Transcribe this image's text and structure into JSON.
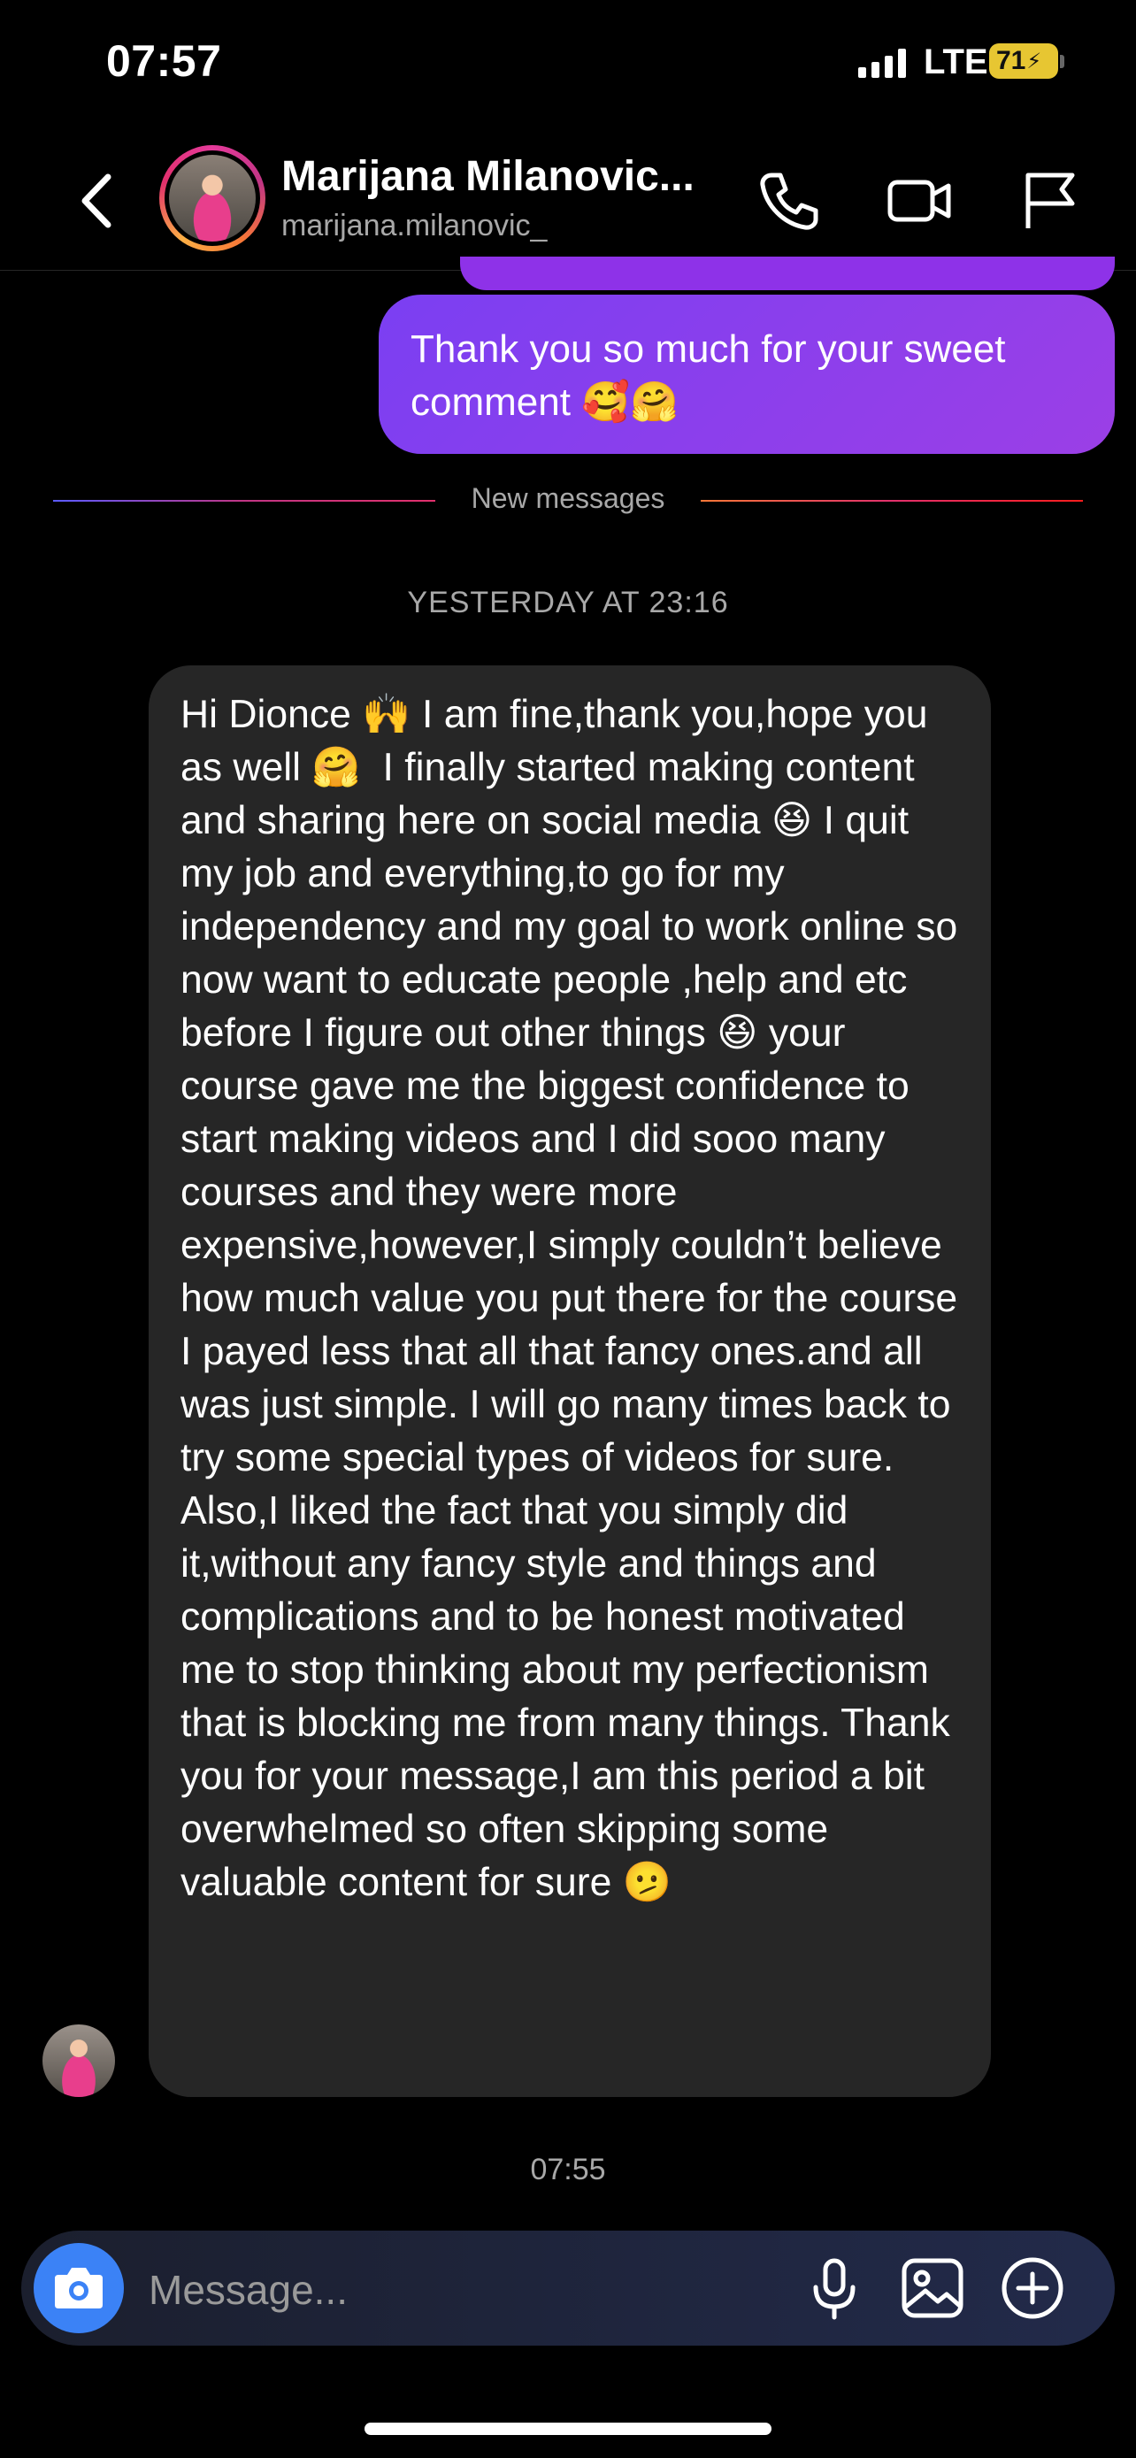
{
  "status_bar": {
    "time": "07:57",
    "network": "LTE",
    "battery": "71",
    "icons": [
      "signal-bars-icon",
      "battery-charging-icon"
    ]
  },
  "header": {
    "name": "Marijana Milanovic...",
    "username": "marijana.milanovic_",
    "icons": [
      "back-chevron-icon",
      "phone-icon",
      "video-camera-icon",
      "flag-icon"
    ]
  },
  "messages": {
    "outgoing_text": "Thank you so much for your sweet comment 🥰🤗",
    "new_messages_label": "New messages",
    "date_separator": "YESTERDAY AT 23:16",
    "incoming_text": "Hi Dionce 🙌 I am fine,thank you,hope you as well 🤗  I finally started making content and sharing here on social media 😆 I quit my job and everything,to go for my independency and my goal to work online so now want to educate people ,help and etc before I figure out other things 😆 your course gave me the biggest confidence to start making videos and I did sooo many courses and they were more expensive,however,I simply couldn’t believe how much value you put there for the course I payed less that all that fancy ones.and all was just simple. I will go many times back to try some special types of videos for sure. Also,I liked the fact that you simply did it,without any fancy style and things and complications and to be honest motivated me to stop thinking about my perfectionism that is blocking me from many things. Thank you for your message,I am this period a bit overwhelmed so often skipping some valuable content for sure 🫤",
    "timestamp": "07:55"
  },
  "composer": {
    "placeholder": "Message...",
    "icons": [
      "camera-icon",
      "microphone-icon",
      "gallery-icon",
      "add-circle-icon"
    ]
  },
  "colors": {
    "background": "#000000",
    "outgoing_bubble": "#8e3fe8",
    "incoming_bubble": "#262626",
    "camera_button": "#3b82f6",
    "battery": "#e7c632"
  }
}
